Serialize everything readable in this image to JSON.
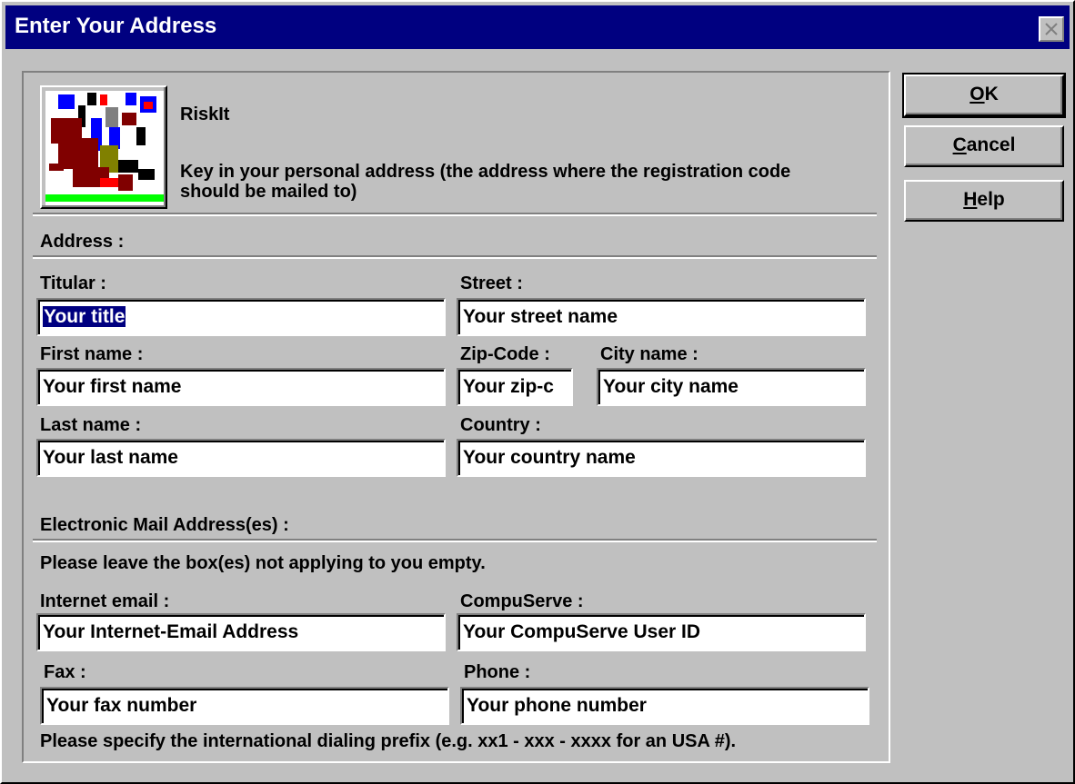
{
  "window": {
    "title": "Enter Your Address"
  },
  "header": {
    "app_name": "RiskIt",
    "instructions": "Key in your personal address (the address where the registration code should be mailed to)",
    "icon": "riskit-app-icon"
  },
  "address": {
    "section_label": "Address :",
    "titular": {
      "label": "Titular :",
      "value": "Your title"
    },
    "street": {
      "label": "Street :",
      "value": "Your street name"
    },
    "first_name": {
      "label": "First name :",
      "value": "Your first name"
    },
    "zip": {
      "label": "Zip-Code :",
      "value": "Your zip-c"
    },
    "city": {
      "label": "City name :",
      "value": "Your city name"
    },
    "last_name": {
      "label": "Last name :",
      "value": "Your last name"
    },
    "country": {
      "label": "Country :",
      "value": "Your country name"
    }
  },
  "email": {
    "section_label": "Electronic Mail Address(es) :",
    "note": "Please leave the box(es) not applying to you empty.",
    "internet": {
      "label": "Internet email :",
      "value": "Your Internet-Email Address"
    },
    "compuserve": {
      "label": "CompuServe :",
      "value": "Your CompuServe User ID"
    },
    "fax": {
      "label": "Fax :",
      "value": "Your fax number"
    },
    "phone": {
      "label": "Phone :",
      "value": "Your phone number"
    },
    "prefix_note": "Please specify the international dialing prefix (e.g. xx1 - xxx - xxxx for an USA #)."
  },
  "buttons": {
    "ok": {
      "mnemonic": "O",
      "rest": "K"
    },
    "cancel": {
      "mnemonic": "C",
      "rest": "ancel"
    },
    "help": {
      "mnemonic": "H",
      "rest": "elp"
    }
  },
  "colors": {
    "face": "#c0c0c0",
    "titlebar": "#000080",
    "selection": "#000080"
  }
}
